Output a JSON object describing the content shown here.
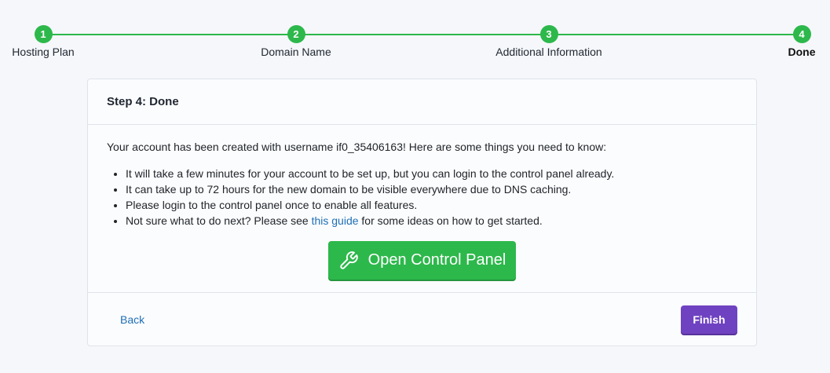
{
  "stepper": {
    "steps": [
      {
        "number": "1",
        "label": "Hosting Plan"
      },
      {
        "number": "2",
        "label": "Domain Name"
      },
      {
        "number": "3",
        "label": "Additional Information"
      },
      {
        "number": "4",
        "label": "Done"
      }
    ],
    "active_step": 4,
    "completed_color": "#2db84b"
  },
  "card": {
    "title": "Step 4: Done",
    "intro": "Your account has been created with username if0_35406163! Here are some things you need to know:",
    "notes": [
      "It will take a few minutes for your account to be set up, but you can login to the control panel already.",
      "It can take up to 72 hours for the new domain to be visible everywhere due to DNS caching.",
      "Please login to the control panel once to enable all features."
    ],
    "last_note": {
      "before": "Not sure what to do next? Please see ",
      "link": "this guide",
      "after": " for some ideas on how to get started."
    },
    "control_panel_button": {
      "label": "Open Control Panel",
      "icon": "wrench-icon",
      "color": "#2db84b"
    }
  },
  "footer": {
    "back_label": "Back",
    "finish_label": "Finish",
    "finish_color": "#6f42c1"
  }
}
